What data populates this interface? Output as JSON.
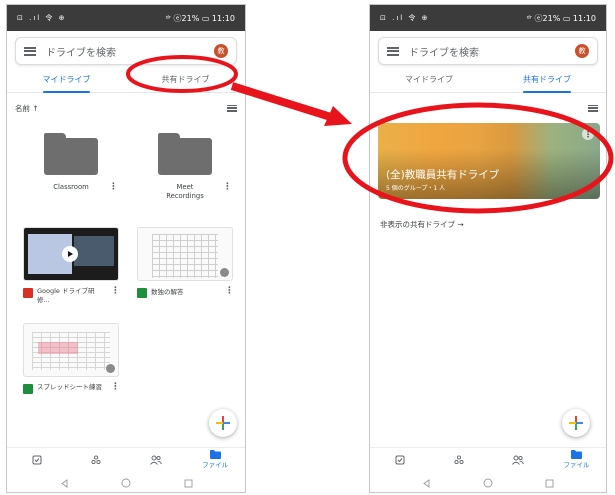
{
  "status_bar": {
    "left_icons": "⊡ .ıl 令 ⊕",
    "right": "ᵈʳ ⓔ21% ▭ 11:10"
  },
  "search": {
    "placeholder": "ドライブを検索",
    "avatar_initial": "教"
  },
  "tabs": {
    "my_drive": "マイドライブ",
    "shared_drives": "共有ドライブ"
  },
  "left_screen": {
    "sort_label": "名前 ↑",
    "folders": [
      {
        "name": "Classroom"
      },
      {
        "name": "Meet\nRecordings"
      }
    ],
    "files": [
      {
        "name": "Google ドライブ研修...",
        "icon": "video-file-icon"
      },
      {
        "name": "数独の解答",
        "icon": "sheets-file-icon"
      },
      {
        "name": "スプレッドシート練習",
        "icon": "sheets-file-icon"
      }
    ]
  },
  "right_screen": {
    "shared_drive": {
      "title": "(全)教職員共有ドライブ",
      "subtitle": "5 個のグループ・1 人"
    },
    "hidden_shared_label": "非表示の共有ドライブ →"
  },
  "bottom_nav": {
    "files_label": "ファイル"
  },
  "colors": {
    "accent": "#1a73e8",
    "annotation": "#e8141c",
    "avatar": "#c8522d"
  }
}
